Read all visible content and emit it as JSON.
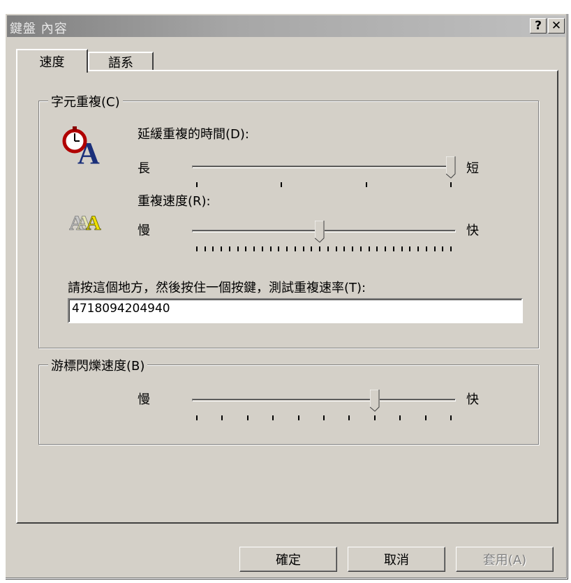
{
  "window": {
    "title": "鍵盤 內容",
    "help_label": "?",
    "close_label": "✕"
  },
  "tabs": [
    {
      "label": "速度",
      "active": true
    },
    {
      "label": "語系",
      "active": false
    }
  ],
  "char_repeat": {
    "group_label": "字元重複(C)",
    "delay": {
      "label": "延緩重複的時間(D):",
      "left": "長",
      "right": "短",
      "value_fraction": 1.0,
      "tick_count": 4
    },
    "rate": {
      "label": "重複速度(R):",
      "left": "慢",
      "right": "快",
      "value_fraction": 0.484,
      "tick_count": 32
    },
    "test_label": "請按這個地方，然後按住一個按鍵，測試重複速率(T):",
    "test_value": "4718094204940"
  },
  "cursor_blink": {
    "group_label": "游標閃爍速度(B)",
    "left": "慢",
    "right": "快",
    "value_fraction": 0.7,
    "tick_count": 11
  },
  "buttons": {
    "ok": "確定",
    "cancel": "取消",
    "apply": "套用(A)"
  }
}
